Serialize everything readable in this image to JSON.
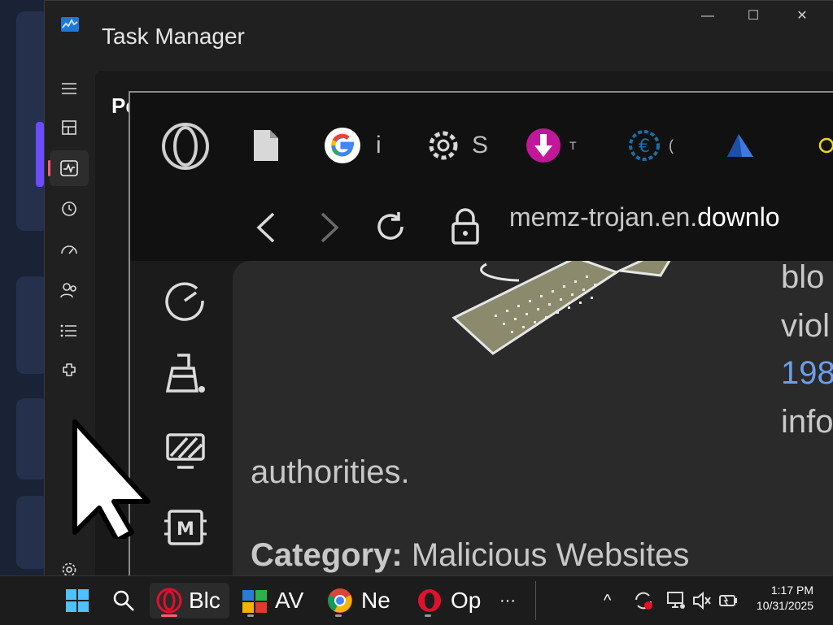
{
  "task_manager": {
    "title": "Task Manager",
    "heading_partial": "Pe",
    "nav_items": [
      "hamburger-icon",
      "processes-icon",
      "performance-icon",
      "app-history-icon",
      "startup-apps-icon",
      "users-icon",
      "details-icon",
      "services-icon",
      "settings-icon"
    ],
    "window_controls": {
      "minimize": "—",
      "maximize": "☐",
      "close": "✕"
    }
  },
  "browser": {
    "tabs": [
      {
        "icon": "document-icon",
        "label": ""
      },
      {
        "icon": "google-icon",
        "label": "i"
      },
      {
        "icon": "settings-gear-icon",
        "label": "S"
      },
      {
        "icon": "download-icon",
        "label": "T"
      },
      {
        "icon": "euro-gear-icon",
        "label": "("
      },
      {
        "icon": "blue-crystal-icon",
        "label": ""
      },
      {
        "icon": "yellow-circle-icon",
        "label": ""
      }
    ],
    "url_prefix": "memz-trojan.en.",
    "url_highlight": "downlo",
    "page": {
      "text_right": [
        "blo",
        "viol",
        "198",
        "info"
      ],
      "link_text": "198",
      "body_line": "authorities.",
      "category_label": "Category:",
      "category_value": "Malicious Websites"
    },
    "sidebar": [
      "speed-dial-icon",
      "cleaner-icon",
      "wallpaper-icon",
      "memory-chip-icon"
    ]
  },
  "taskbar": {
    "items": [
      {
        "name": "windows-start-icon",
        "label": ""
      },
      {
        "name": "search-icon",
        "label": ""
      },
      {
        "name": "opera-gx-icon",
        "label": "Blc"
      },
      {
        "name": "avg-icon",
        "label": "AV"
      },
      {
        "name": "chrome-icon",
        "label": "Ne"
      },
      {
        "name": "opera-icon",
        "label": "Op"
      }
    ],
    "more": "···",
    "tray_chevron": "^",
    "time": "1:17 PM",
    "date": "10/31/2025"
  },
  "colors": {
    "link": "#6d9ee8",
    "accent_red": "#ff5e6e",
    "taskbar_bg": "#1c1c1c"
  }
}
